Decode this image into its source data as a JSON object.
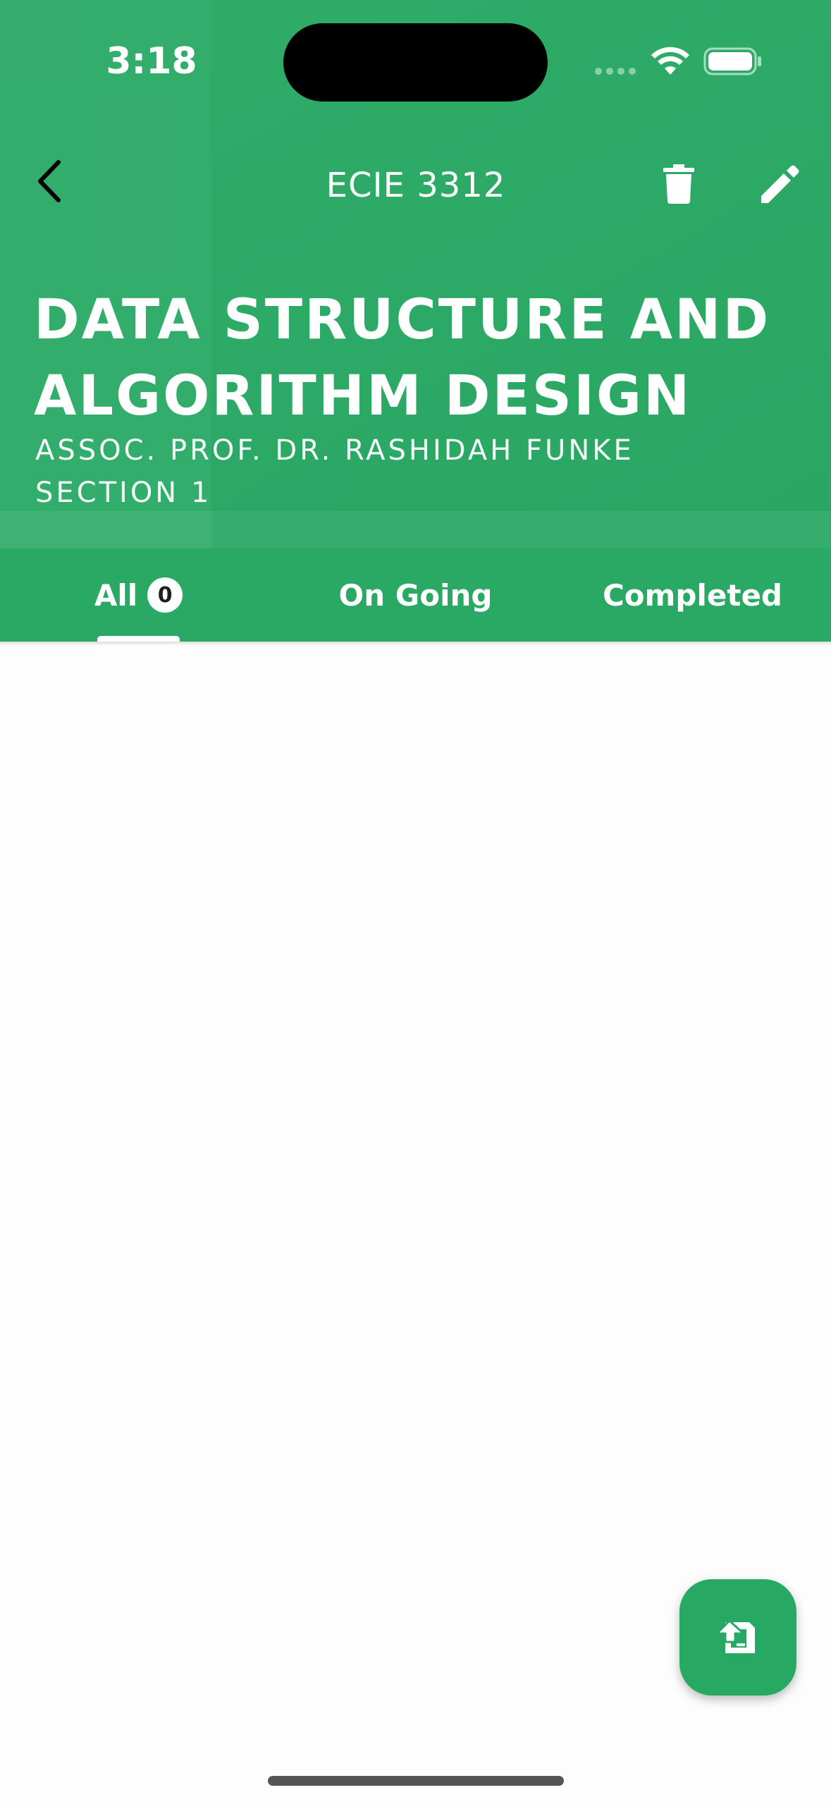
{
  "status_bar": {
    "time": "3:18"
  },
  "nav": {
    "title": "ECIE 3312",
    "icons": {
      "back": "chevron-left-icon",
      "delete": "trash-icon",
      "edit": "pencil-icon"
    }
  },
  "course": {
    "title": "DATA STRUCTURE AND ALGORITHM DESIGN",
    "lecturer": "ASSOC. PROF. DR. RASHIDAH FUNKE",
    "section": "SECTION 1"
  },
  "tabs": [
    {
      "label": "All",
      "count": "0",
      "selected": true
    },
    {
      "label": "On Going",
      "selected": false
    },
    {
      "label": "Completed",
      "selected": false
    }
  ],
  "fab": {
    "icon": "add-task-icon"
  },
  "colors": {
    "primary": "#29a964",
    "on_primary": "#ffffff",
    "background": "#fdfdfd"
  }
}
